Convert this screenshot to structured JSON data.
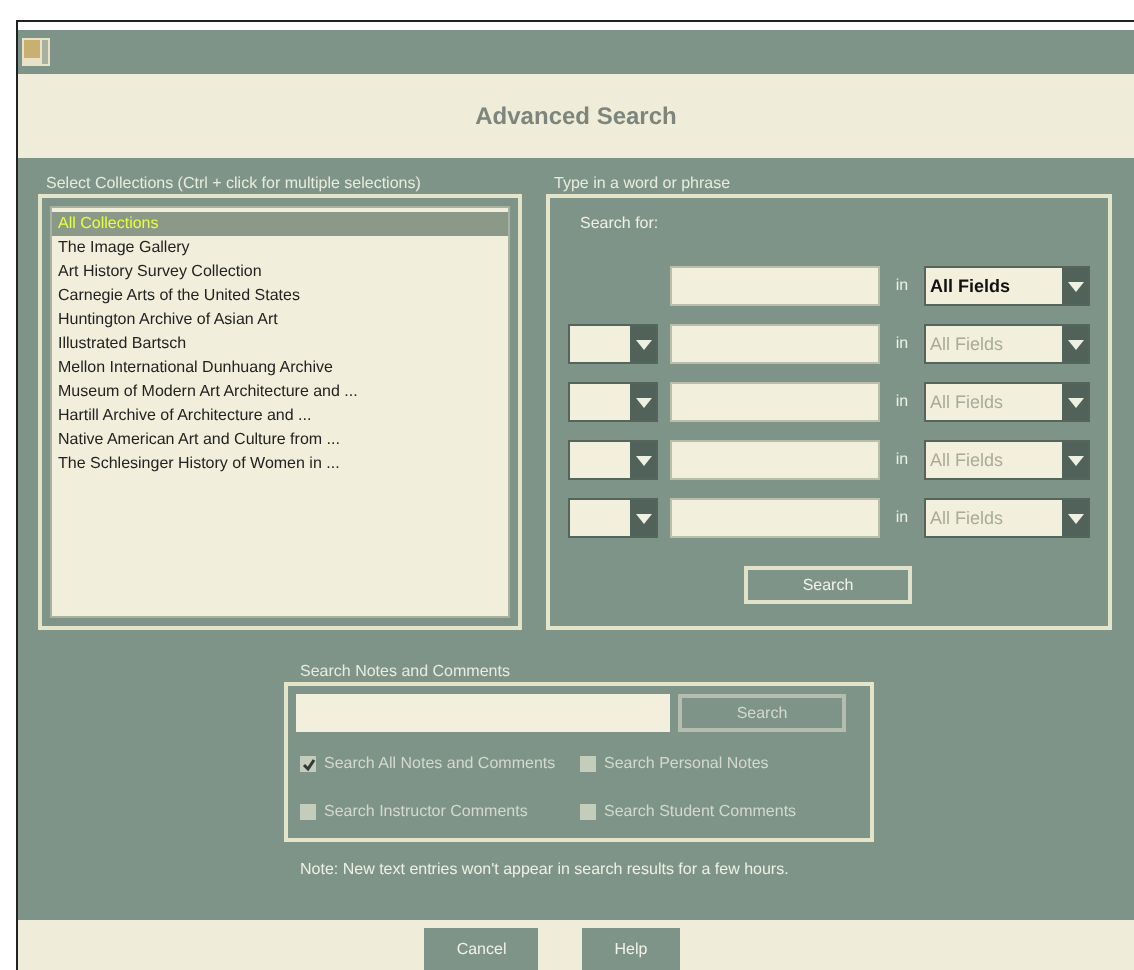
{
  "window": {
    "title": "Advanced Search"
  },
  "collections": {
    "label": "Select Collections (Ctrl + click for multiple selections)",
    "items": [
      {
        "label": "All Collections",
        "selected": true
      },
      {
        "label": "The Image Gallery",
        "selected": false
      },
      {
        "label": "Art History Survey Collection",
        "selected": false
      },
      {
        "label": "Carnegie Arts of the United States",
        "selected": false
      },
      {
        "label": "Huntington Archive of Asian Art",
        "selected": false
      },
      {
        "label": "Illustrated Bartsch",
        "selected": false
      },
      {
        "label": "Mellon International Dunhuang Archive",
        "selected": false
      },
      {
        "label": "Museum of Modern Art Architecture and ...",
        "selected": false
      },
      {
        "label": "Hartill Archive of Architecture and ...",
        "selected": false
      },
      {
        "label": "Native American Art and Culture from ...",
        "selected": false
      },
      {
        "label": "The Schlesinger History of Women in ...",
        "selected": false
      }
    ]
  },
  "search": {
    "label": "Type in a word or phrase",
    "search_for": "Search for:",
    "rows": [
      {
        "kind": "first",
        "in": "in",
        "field": "All Fields",
        "disabled": false
      },
      {
        "kind": "extra",
        "in": "in",
        "field": "All Fields",
        "disabled": true
      },
      {
        "kind": "extra",
        "in": "in",
        "field": "All Fields",
        "disabled": true
      },
      {
        "kind": "extra",
        "in": "in",
        "field": "All Fields",
        "disabled": true
      },
      {
        "kind": "extra",
        "in": "in",
        "field": "All Fields",
        "disabled": true
      }
    ],
    "button": "Search"
  },
  "notes": {
    "label": "Search Notes and Comments",
    "button": "Search",
    "button_disabled": true,
    "options": [
      {
        "label": "Search All Notes and Comments",
        "checked": true,
        "disabled": true
      },
      {
        "label": "Search Personal Notes",
        "checked": false,
        "disabled": true
      },
      {
        "label": "Search Instructor Comments",
        "checked": false,
        "disabled": true
      },
      {
        "label": "Search Student Comments",
        "checked": false,
        "disabled": true
      }
    ]
  },
  "note": "Note: New text entries won't appear in search results for a few hours.",
  "buttons": [
    "Cancel",
    "Help"
  ]
}
